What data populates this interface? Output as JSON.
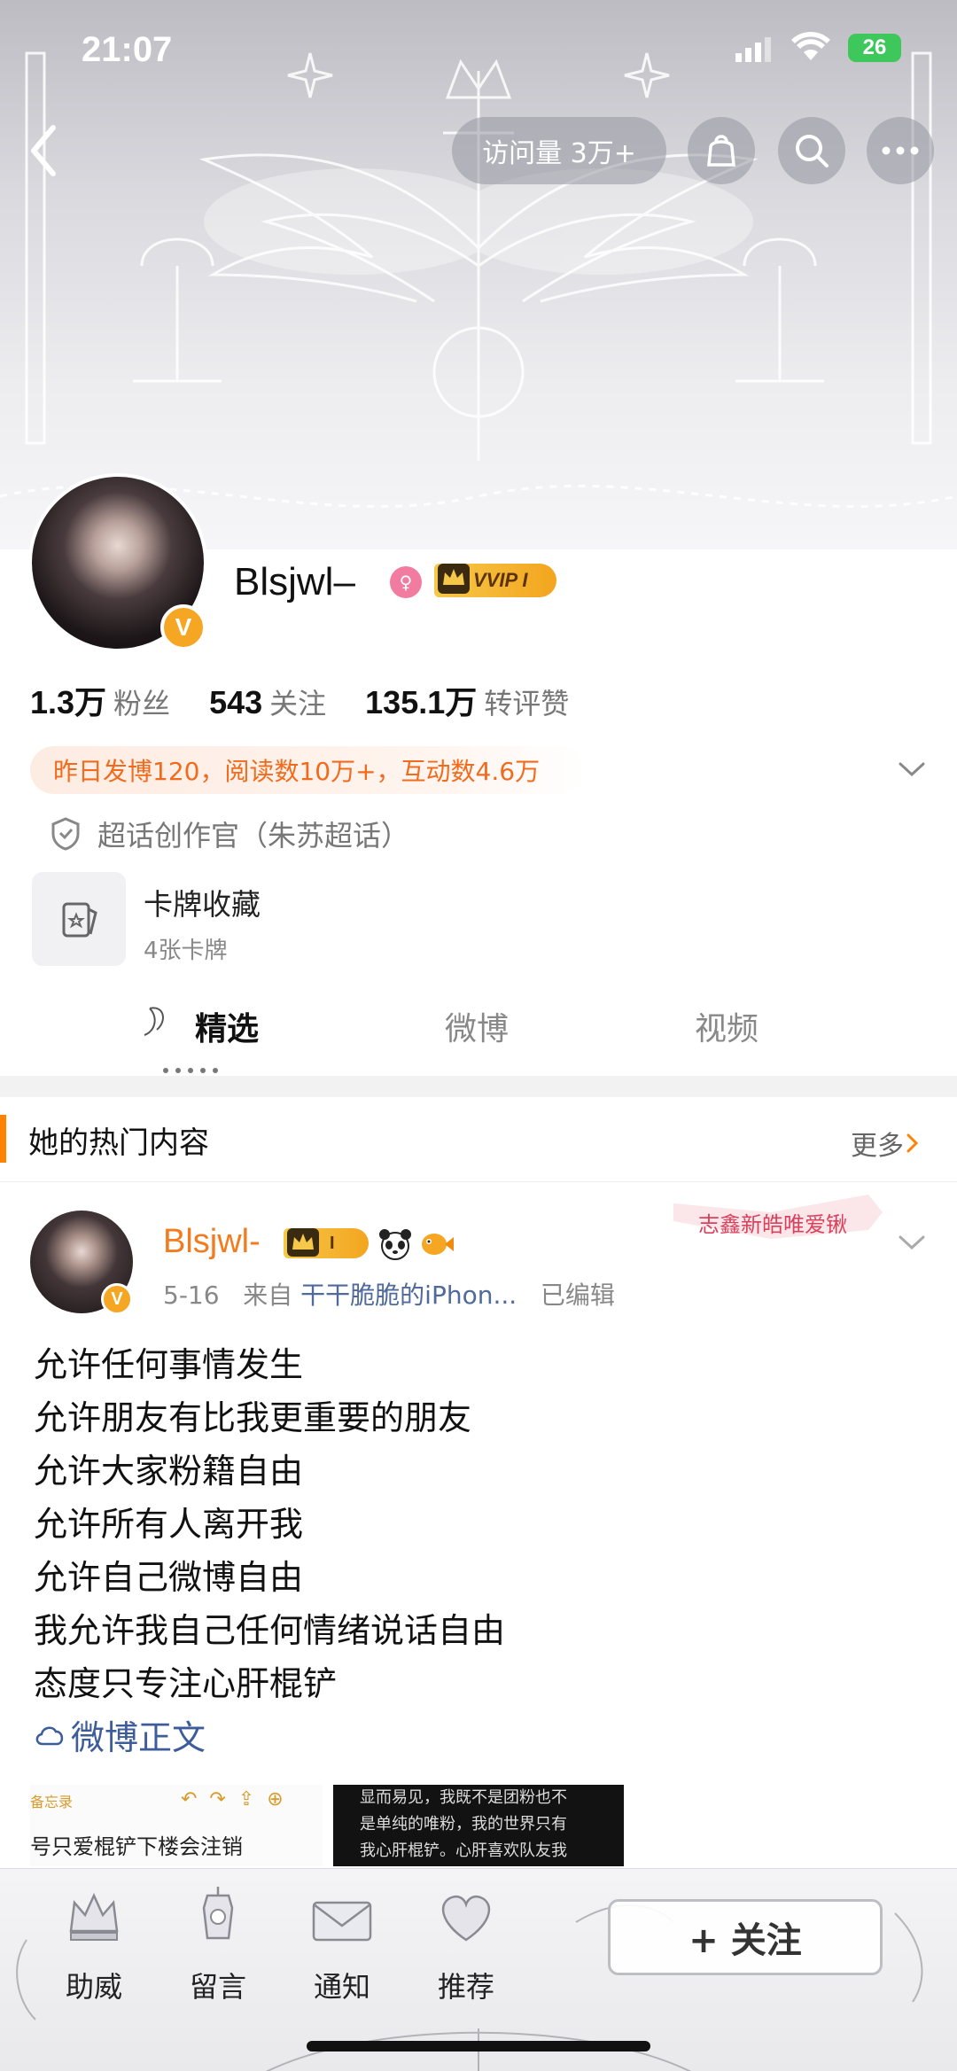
{
  "status_bar": {
    "time": "21:07",
    "battery": "26"
  },
  "header": {
    "visits": "访问量 3万+"
  },
  "profile": {
    "username": "Blsjwl–",
    "vvip_label": "VVIP I",
    "verified_mark": "V",
    "stats": [
      {
        "value": "1.3万",
        "label": "粉丝"
      },
      {
        "value": "543",
        "label": "关注"
      },
      {
        "value": "135.1万",
        "label": "转评赞"
      }
    ],
    "highlight": "昨日发博120，阅读数10万+，互动数4.6万",
    "creator_title": "超话创作官（朱苏超话）",
    "card": {
      "title": "卡牌收藏",
      "subtitle": "4张卡牌"
    }
  },
  "tabs": [
    {
      "label": "精选",
      "active": true
    },
    {
      "label": "微博",
      "active": false
    },
    {
      "label": "视频",
      "active": false
    }
  ],
  "hot_section": {
    "title": "她的热门内容",
    "more": "更多"
  },
  "post": {
    "author": "Blsjwl-",
    "vip_level": "I",
    "date": "5-16",
    "from_prefix": "来自",
    "source": "干干脆脆的iPhon...",
    "edited": "已编辑",
    "sticker_text": "志鑫新皓唯爱锹",
    "lines": [
      "允许任何事情发生",
      "允许朋友有比我更重要的朋友",
      "允许大家粉籍自由",
      "允许所有人离开我",
      "允许自己微博自由",
      "我允许我自己任何情绪说话自由",
      "态度只专注心肝棍铲"
    ],
    "link_label": "微博正文",
    "image_left": {
      "title": "备忘录",
      "text": "号只爱棍铲下楼会注销"
    },
    "image_right": {
      "lines": [
        "显而易见，我既不是团粉也不",
        "是单纯的唯粉，我的世界只有",
        "我心肝棍铲。心肝喜欢队友我"
      ]
    }
  },
  "bottom_bar": {
    "items": [
      {
        "label": "助威",
        "icon": "crown-icon"
      },
      {
        "label": "留言",
        "icon": "lantern-icon"
      },
      {
        "label": "通知",
        "icon": "envelope-icon"
      },
      {
        "label": "推荐",
        "icon": "heart-icon"
      }
    ],
    "follow_label": "+ 关注"
  },
  "colors": {
    "accent_orange": "#ff8200",
    "author_orange": "#f37b1d",
    "link_blue": "#3d5c9a",
    "highlight_text": "#f26b1d"
  }
}
